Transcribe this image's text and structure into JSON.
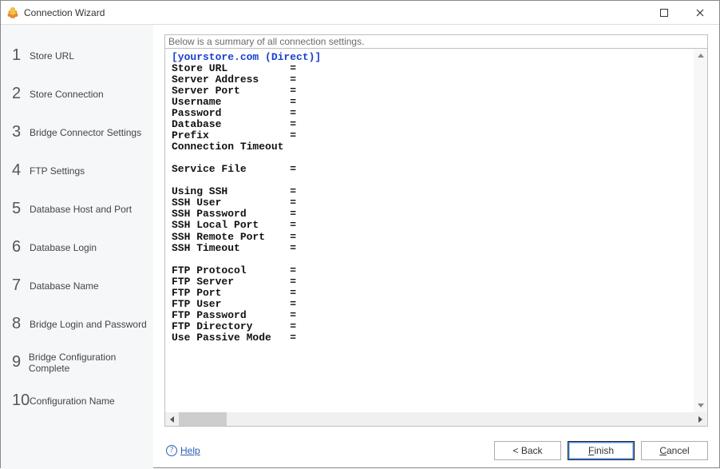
{
  "window": {
    "title": "Connection Wizard"
  },
  "steps": [
    {
      "num": "1",
      "label": "Store URL"
    },
    {
      "num": "2",
      "label": "Store Connection"
    },
    {
      "num": "3",
      "label": "Bridge Connector Settings"
    },
    {
      "num": "4",
      "label": "FTP Settings"
    },
    {
      "num": "5",
      "label": "Database Host and Port"
    },
    {
      "num": "6",
      "label": "Database Login"
    },
    {
      "num": "7",
      "label": "Database Name"
    },
    {
      "num": "8",
      "label": "Bridge Login and Password"
    },
    {
      "num": "9",
      "label": "Bridge Configuration Complete"
    },
    {
      "num": "10",
      "label": "Configuration Name"
    }
  ],
  "summary": {
    "caption": "Below is a summary of all connection settings.",
    "section_header": "[yourstore.com (Direct)]",
    "entries": [
      {
        "key": "Store URL",
        "sep": "= ",
        "value": "                         "
      },
      {
        "key": "Server Address",
        "sep": "= ",
        "value": "                   "
      },
      {
        "key": "Server Port",
        "sep": "= ",
        "value": "     "
      },
      {
        "key": "Username",
        "sep": "= ",
        "value": "       "
      },
      {
        "key": "Password",
        "sep": "= ",
        "value": "       "
      },
      {
        "key": "Database",
        "sep": "= ",
        "value": "                          "
      },
      {
        "key": "Prefix",
        "sep": "= ",
        "value": ""
      },
      {
        "key": "Connection Timeout",
        "sep": "  ",
        "value": "        "
      },
      {
        "key": "",
        "sep": "",
        "value": ""
      },
      {
        "key": "Service File",
        "sep": "= ",
        "value": "                      "
      },
      {
        "key": "",
        "sep": "",
        "value": ""
      },
      {
        "key": "Using SSH",
        "sep": "= ",
        "value": "  "
      },
      {
        "key": "SSH User",
        "sep": "= ",
        "value": ""
      },
      {
        "key": "SSH Password",
        "sep": "= ",
        "value": "          "
      },
      {
        "key": "SSH Local Port",
        "sep": "= ",
        "value": "    "
      },
      {
        "key": "SSH Remote Port",
        "sep": "= ",
        "value": "   "
      },
      {
        "key": "SSH Timeout",
        "sep": "= ",
        "value": "    "
      },
      {
        "key": "",
        "sep": "",
        "value": ""
      },
      {
        "key": "FTP Protocol",
        "sep": "= ",
        "value": "    "
      },
      {
        "key": "FTP Server",
        "sep": "= ",
        "value": "                 "
      },
      {
        "key": "FTP Port",
        "sep": "= ",
        "value": "   "
      },
      {
        "key": "FTP User",
        "sep": "= ",
        "value": "       "
      },
      {
        "key": "FTP Password",
        "sep": "= ",
        "value": "       "
      },
      {
        "key": "FTP Directory",
        "sep": "= ",
        "value": "                                          "
      },
      {
        "key": "Use Passive Mode",
        "sep": "= ",
        "value": "   "
      }
    ],
    "label_width": 19
  },
  "footer": {
    "help": "Help",
    "back": "< Back",
    "finish_pre": "",
    "finish_m": "F",
    "finish_post": "inish",
    "cancel_pre": "",
    "cancel_m": "C",
    "cancel_post": "ancel"
  }
}
